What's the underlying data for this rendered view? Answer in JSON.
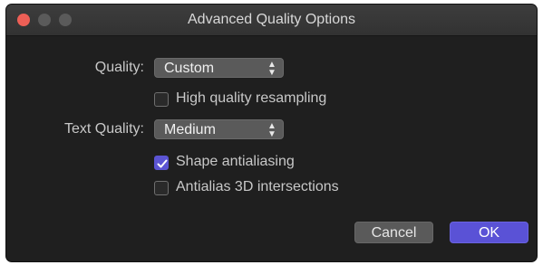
{
  "window": {
    "title": "Advanced Quality Options"
  },
  "quality": {
    "label": "Quality:",
    "value": "Custom"
  },
  "high_quality_resampling": {
    "label": "High quality resampling",
    "checked": false
  },
  "text_quality": {
    "label": "Text Quality:",
    "value": "Medium"
  },
  "shape_antialiasing": {
    "label": "Shape antialiasing",
    "checked": true
  },
  "antialias_3d": {
    "label": "Antialias 3D intersections",
    "checked": false
  },
  "buttons": {
    "cancel": "Cancel",
    "ok": "OK"
  },
  "colors": {
    "accent": "#5a52d6",
    "close": "#ed5f56",
    "background": "#1f1f1f"
  },
  "icons": {
    "select_arrows": "up-down-chevron-icon",
    "checkmark": "checkmark-icon"
  }
}
